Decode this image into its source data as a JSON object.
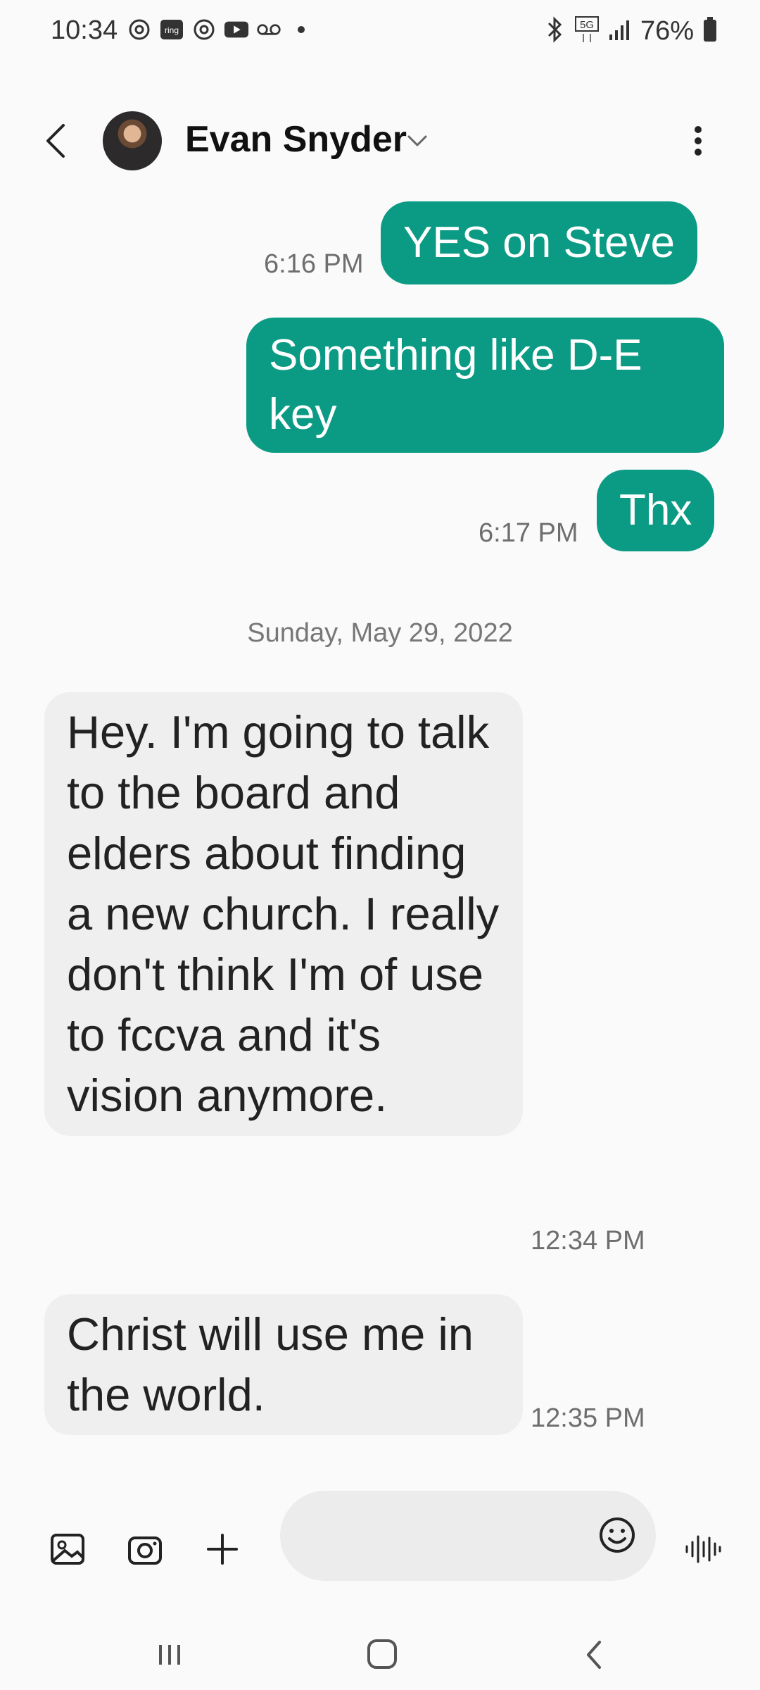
{
  "status_bar": {
    "time": "10:34",
    "network": "5G",
    "battery": "76%",
    "icons": [
      "threads-icon",
      "ring-icon",
      "threads-icon",
      "youtube-icon",
      "voicemail-icon",
      "dot-icon",
      "bluetooth-icon",
      "network-5g-icon",
      "signal-icon",
      "battery-icon"
    ]
  },
  "header": {
    "contact_name": "Evan Snyder",
    "icons": [
      "back-arrow-icon",
      "avatar",
      "chevron-down-icon",
      "more-vert-icon"
    ]
  },
  "messages": [
    {
      "direction": "out",
      "text": "YES on Steve",
      "time": "6:16 PM"
    },
    {
      "direction": "out",
      "text": "Something like D-E key",
      "time": ""
    },
    {
      "direction": "out",
      "text": "Thx",
      "time": "6:17 PM"
    },
    {
      "direction": "separator",
      "text": "Sunday, May 29, 2022"
    },
    {
      "direction": "in",
      "text": "Hey.  I'm going to talk to the board and elders about finding a new church.  I really don't think I'm of use to fccva and it's vision anymore.",
      "time": "12:34 PM"
    },
    {
      "direction": "in",
      "text": "Christ will use me in the world.",
      "time": "12:35 PM"
    }
  ],
  "input_bar": {
    "placeholder": "",
    "value": "",
    "icons": [
      "gallery-icon",
      "camera-icon",
      "plus-icon",
      "emoji-icon",
      "voice-icon"
    ]
  },
  "nav_bar": {
    "icons": [
      "recent-apps-icon",
      "home-icon",
      "back-icon"
    ]
  },
  "colors": {
    "outgoing_bubble": "#0b9b84",
    "incoming_bubble": "#efefef",
    "background": "#fafafb"
  }
}
